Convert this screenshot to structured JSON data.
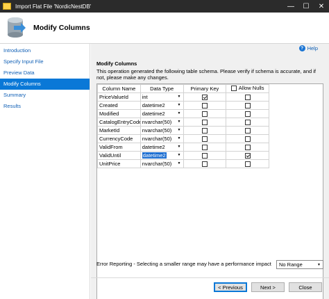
{
  "window": {
    "title": "Import Flat File 'NordicNestDB'",
    "controls": {
      "minimize": "—",
      "maximize": "☐",
      "close": "✕"
    }
  },
  "header": {
    "title": "Modify Columns",
    "icon": "database-import-icon"
  },
  "sidebar": {
    "items": [
      {
        "label": "Introduction",
        "active": false
      },
      {
        "label": "Specify Input File",
        "active": false
      },
      {
        "label": "Preview Data",
        "active": false
      },
      {
        "label": "Modify Columns",
        "active": true
      },
      {
        "label": "Summary",
        "active": false
      },
      {
        "label": "Results",
        "active": false
      }
    ]
  },
  "main": {
    "help_label": "Help",
    "section_title": "Modify Columns",
    "description": "This operation generated the following table schema. Please verify if schema is accurate, and if not, please make any changes.",
    "table": {
      "headers": {
        "column_name": "Column Name",
        "data_type": "Data Type",
        "primary_key": "Primary Key",
        "allow_nulls": "Allow Nulls"
      },
      "allow_nulls_header_checked": false,
      "rows": [
        {
          "name": "PriceValueId",
          "type": "int",
          "pk": true,
          "nulls": false
        },
        {
          "name": "Created",
          "type": "datetime2",
          "pk": false,
          "nulls": false
        },
        {
          "name": "Modified",
          "type": "datetime2",
          "pk": false,
          "nulls": false
        },
        {
          "name": "CatalogEntryCode",
          "type": "nvarchar(50)",
          "pk": false,
          "nulls": false
        },
        {
          "name": "MarketId",
          "type": "nvarchar(50)",
          "pk": false,
          "nulls": false
        },
        {
          "name": "CurrencyCode",
          "type": "nvarchar(50)",
          "pk": false,
          "nulls": false
        },
        {
          "name": "ValidFrom",
          "type": "datetime2",
          "pk": false,
          "nulls": false
        },
        {
          "name": "ValidUntil",
          "type": "datetime2",
          "pk": false,
          "nulls": true,
          "selected": true
        },
        {
          "name": "UnitPrice",
          "type": "nvarchar(50)",
          "pk": false,
          "nulls": false
        }
      ]
    },
    "error_reporting": {
      "label": "Error Reporting - Selecting a smaller range may have a performance impact",
      "value": "No Range"
    }
  },
  "footer": {
    "previous_label": "< Previous",
    "next_label": "Next >",
    "close_label": "Close"
  },
  "colors": {
    "accent": "#0a78d7",
    "link": "#0f5fb5",
    "titlebar": "#2b2b2b",
    "content_bg": "#f0f0f0"
  }
}
